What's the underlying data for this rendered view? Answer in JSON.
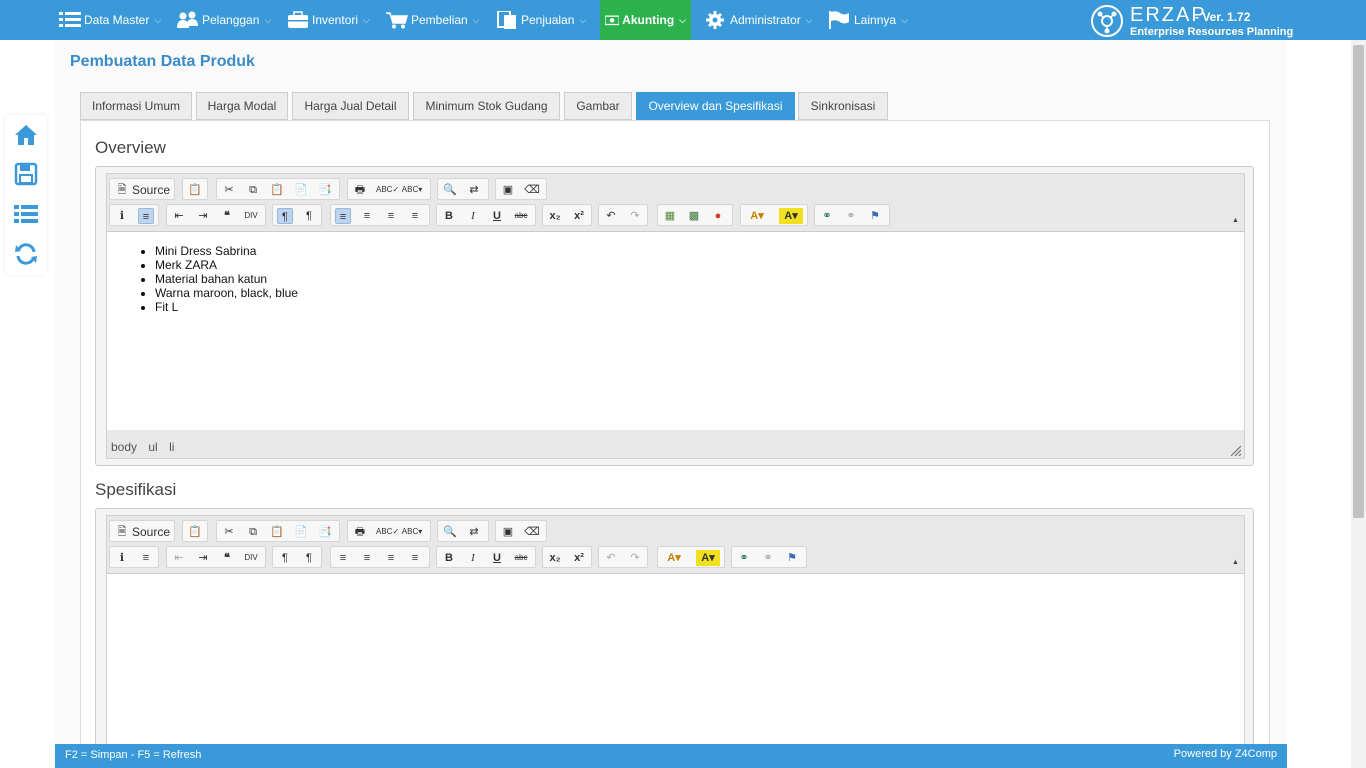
{
  "nav": {
    "items": [
      {
        "label": "Data Master",
        "icon": "list-icon"
      },
      {
        "label": "Pelanggan",
        "icon": "users-icon"
      },
      {
        "label": "Inventori",
        "icon": "briefcase-icon"
      },
      {
        "label": "Pembelian",
        "icon": "cart-icon"
      },
      {
        "label": "Penjualan",
        "icon": "document-icon"
      },
      {
        "label": "Akunting",
        "icon": "money-icon"
      },
      {
        "label": "Administrator",
        "icon": "gear-icon"
      },
      {
        "label": "Lainnya",
        "icon": "flag-icon"
      }
    ],
    "active_color": "#2bb24c",
    "bar_color": "#3a9ad9"
  },
  "brand": {
    "name": "ERZAP",
    "version": "- Ver. 1.72",
    "tagline": "Enterprise Resources Planning"
  },
  "page": {
    "title": "Pembuatan Data Produk"
  },
  "tabs": [
    {
      "label": "Informasi Umum"
    },
    {
      "label": "Harga Modal"
    },
    {
      "label": "Harga Jual Detail"
    },
    {
      "label": "Minimum Stok Gudang"
    },
    {
      "label": "Gambar"
    },
    {
      "label": "Overview dan Spesifikasi",
      "active": true
    },
    {
      "label": "Sinkronisasi"
    }
  ],
  "overview": {
    "title": "Overview",
    "source_label": "Source",
    "content_items": [
      "Mini Dress Sabrina",
      "Merk ZARA",
      "Material bahan katun",
      "Warna maroon, black, blue",
      "Fit L"
    ],
    "path": [
      "body",
      "ul",
      "li"
    ]
  },
  "spesifikasi": {
    "title": "Spesifikasi",
    "source_label": "Source"
  },
  "footer": {
    "shortcuts": "F2 = Simpan - F5 = Refresh",
    "powered": "Powered by Z4Comp"
  }
}
